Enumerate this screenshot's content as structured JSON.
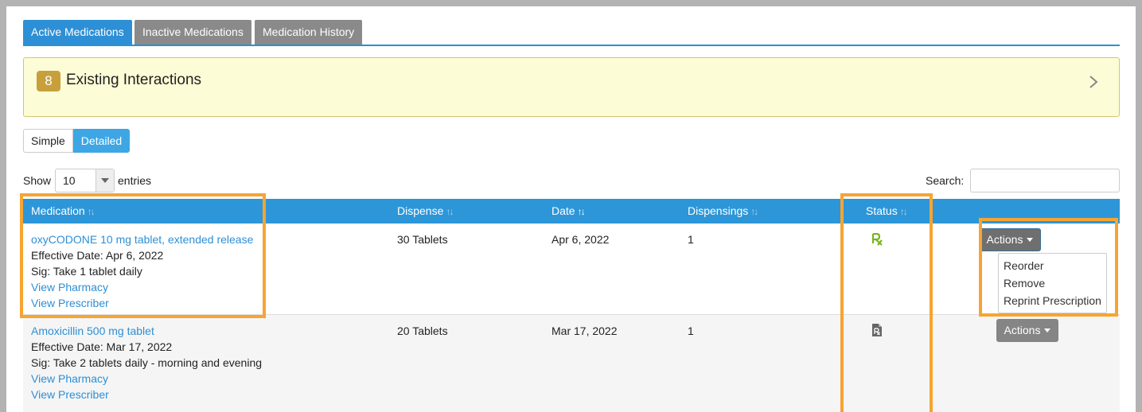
{
  "tabs": [
    {
      "label": "Active Medications"
    },
    {
      "label": "Inactive Medications"
    },
    {
      "label": "Medication History"
    }
  ],
  "interactions": {
    "count": "8",
    "label": "Existing Interactions"
  },
  "view_toggle": {
    "simple": "Simple",
    "detailed": "Detailed"
  },
  "entries": {
    "show_label": "Show",
    "value": "10",
    "entries_label": "entries"
  },
  "search": {
    "label": "Search:",
    "value": ""
  },
  "table": {
    "columns": [
      "Medication",
      "Dispense",
      "Date",
      "Dispensings",
      "Status"
    ],
    "rows": [
      {
        "name": "oxyCODONE 10 mg tablet, extended release",
        "effective": "Effective Date: Apr 6, 2022",
        "sig": "Sig: Take 1 tablet daily",
        "view_pharmacy": "View Pharmacy",
        "view_prescriber": "View Prescriber",
        "dispense": "30 Tablets",
        "date": "Apr 6, 2022",
        "dispensings": "1",
        "status_icon": "rx-green-icon",
        "actions": "Actions"
      },
      {
        "name": "Amoxicillin 500 mg tablet",
        "effective": "Effective Date: Mar 17, 2022",
        "sig": "Sig: Take 2 tablets daily - morning and evening",
        "view_pharmacy": "View Pharmacy",
        "view_prescriber": "View Prescriber",
        "dispense": "20 Tablets",
        "date": "Mar 17, 2022",
        "dispensings": "1",
        "status_icon": "rx-document-icon",
        "actions": "Actions"
      }
    ]
  },
  "actions_menu": [
    "Reorder",
    "Remove",
    "Reprint Prescription"
  ],
  "colors": {
    "accent": "#2d8fd5",
    "highlight": "#f6a432",
    "rx_green": "#7ab51d"
  }
}
